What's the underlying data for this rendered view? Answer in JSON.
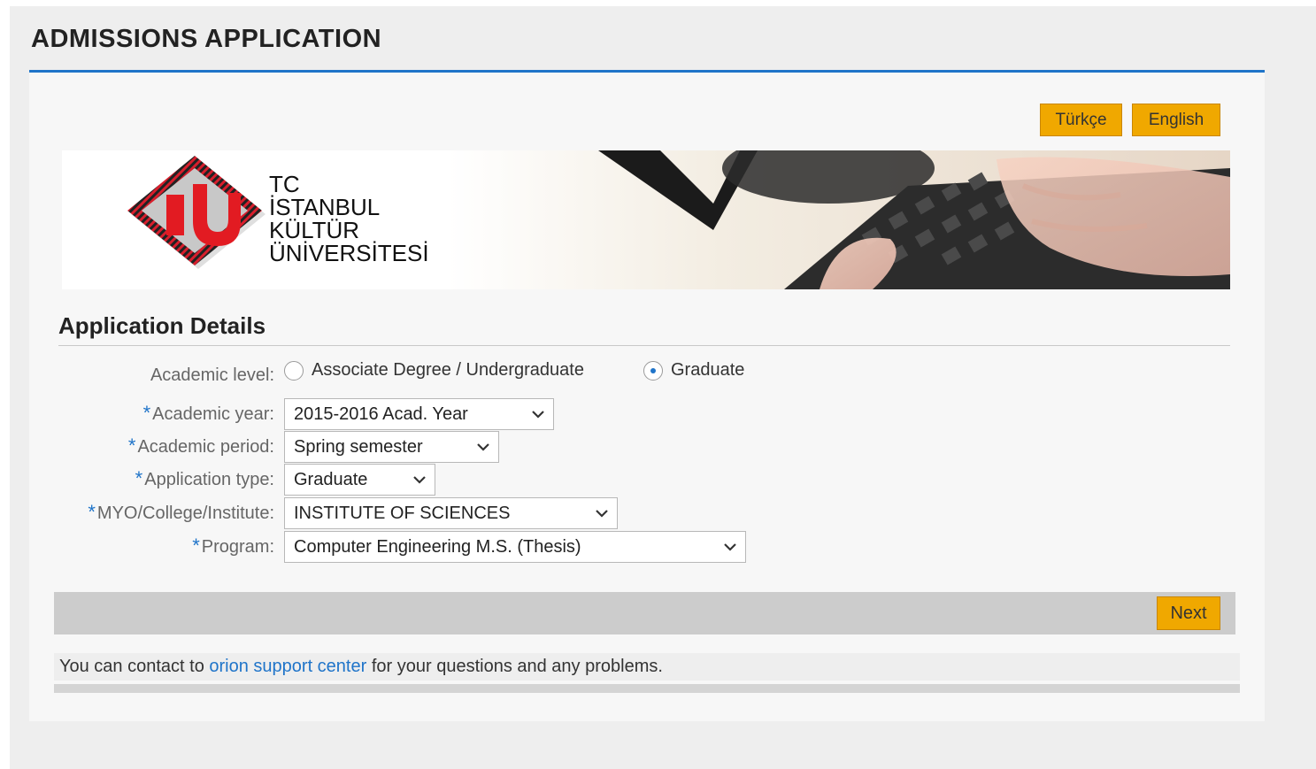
{
  "header": {
    "title": "ADMISSIONS APPLICATION"
  },
  "language": {
    "turkish": "Türkçe",
    "english": "English"
  },
  "banner": {
    "logo_lines": [
      "TC",
      "İSTANBUL",
      "KÜLTÜR",
      "ÜNİVERSİTESİ"
    ]
  },
  "section": {
    "title": "Application Details"
  },
  "form": {
    "academic_level": {
      "label": "Academic level:",
      "options": [
        "Associate Degree / Undergraduate",
        "Graduate"
      ],
      "selected": "Graduate"
    },
    "academic_year": {
      "label": "Academic year:",
      "value": "2015-2016 Acad. Year"
    },
    "academic_period": {
      "label": "Academic period:",
      "value": "Spring semester"
    },
    "application_type": {
      "label": "Application type:",
      "value": "Graduate"
    },
    "institute": {
      "label": "MYO/College/Institute:",
      "value": "INSTITUTE OF SCIENCES"
    },
    "program": {
      "label": "Program:",
      "value": "Computer Engineering M.S. (Thesis)"
    },
    "required_mark": "*"
  },
  "actions": {
    "next": "Next"
  },
  "footer": {
    "contact_prefix": "You can contact to",
    "contact_link": "orion support center",
    "contact_suffix": "for your questions and any problems."
  },
  "colors": {
    "accent": "#1f74c9",
    "button": "#f0a800",
    "footer_bar": "#cccccc"
  }
}
